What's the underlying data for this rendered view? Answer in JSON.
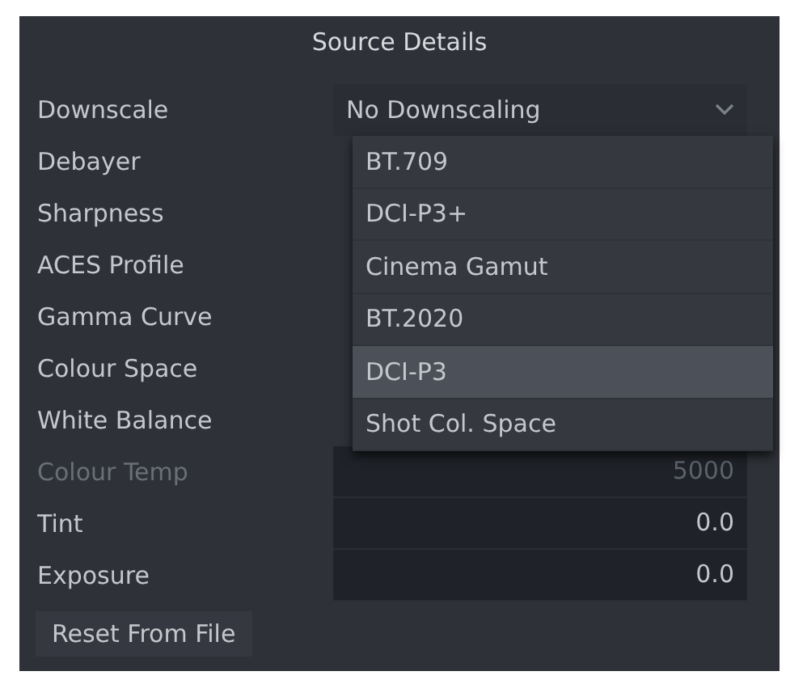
{
  "panel": {
    "title": "Source Details"
  },
  "rows": [
    {
      "label": "Downscale",
      "disabled": false,
      "kind": "dropdown",
      "value": "No Downscaling"
    },
    {
      "label": "Debayer",
      "disabled": false
    },
    {
      "label": "Sharpness",
      "disabled": false
    },
    {
      "label": "ACES Profile",
      "disabled": false
    },
    {
      "label": "Gamma Curve",
      "disabled": false
    },
    {
      "label": "Colour Space",
      "disabled": false
    },
    {
      "label": "White Balance",
      "disabled": false
    },
    {
      "label": "Colour Temp",
      "disabled": true,
      "kind": "number",
      "value": "5000"
    },
    {
      "label": "Tint",
      "disabled": false,
      "kind": "number",
      "value": "0.0"
    },
    {
      "label": "Exposure",
      "disabled": false,
      "kind": "number",
      "value": "0.0"
    }
  ],
  "menu": [
    {
      "label": "BT.709",
      "selected": false
    },
    {
      "label": "DCI-P3+",
      "selected": false
    },
    {
      "label": "Cinema Gamut",
      "selected": false
    },
    {
      "label": "BT.2020",
      "selected": false
    },
    {
      "label": "DCI-P3",
      "selected": true
    },
    {
      "label": "Shot Col. Space",
      "selected": false
    }
  ],
  "reset_button": "Reset From File"
}
